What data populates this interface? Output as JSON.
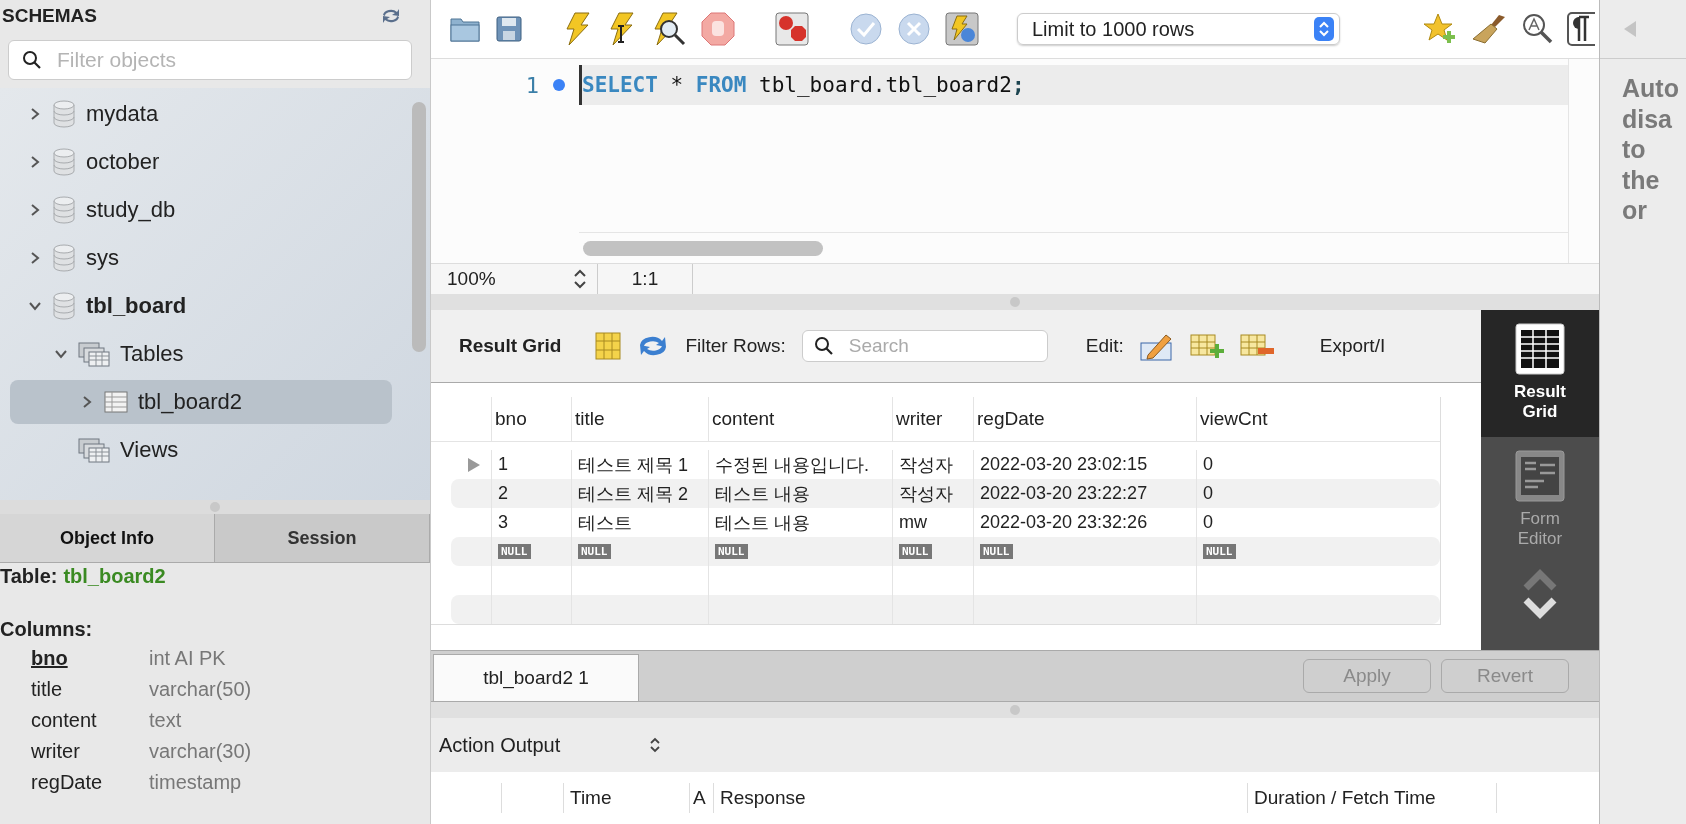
{
  "schemas_panel": {
    "title": "SCHEMAS",
    "filter": {
      "placeholder": "Filter objects"
    },
    "tree": [
      {
        "label": "mydata",
        "kind": "schema",
        "expanded": false,
        "selected": false
      },
      {
        "label": "october",
        "kind": "schema",
        "expanded": false,
        "selected": false
      },
      {
        "label": "study_db",
        "kind": "schema",
        "expanded": false,
        "selected": false
      },
      {
        "label": "sys",
        "kind": "schema",
        "expanded": false,
        "selected": false
      },
      {
        "label": "tbl_board",
        "kind": "schema",
        "expanded": true,
        "selected": false,
        "children": [
          {
            "label": "Tables",
            "kind": "folder",
            "expanded": true,
            "selected": false,
            "children": [
              {
                "label": "tbl_board2",
                "kind": "table",
                "expanded": false,
                "selected": true
              }
            ]
          },
          {
            "label": "Views",
            "kind": "folder",
            "selected": false
          }
        ]
      }
    ]
  },
  "info_tabs": [
    {
      "label": "Object Info",
      "selected": true
    },
    {
      "label": "Session",
      "selected": false
    }
  ],
  "object_info": {
    "table_label": "Table:",
    "table_name": "tbl_board2",
    "columns_label": "Columns:",
    "columns": [
      {
        "name": "bno",
        "type": "int AI PK",
        "primary": true
      },
      {
        "name": "title",
        "type": "varchar(50)",
        "primary": false
      },
      {
        "name": "content",
        "type": "text",
        "primary": false
      },
      {
        "name": "writer",
        "type": "varchar(30)",
        "primary": false
      },
      {
        "name": "regDate",
        "type": "timestamp",
        "primary": false
      }
    ]
  },
  "toolbar": {
    "limit": "Limit to 1000 rows"
  },
  "editor": {
    "lines": [
      {
        "number": "1",
        "tokens": [
          {
            "text": "SELECT",
            "kind": "keyword"
          },
          {
            "text": " * ",
            "kind": "plain"
          },
          {
            "text": "FROM",
            "kind": "keyword"
          },
          {
            "text": " tbl_board.tbl_board2",
            "kind": "plain"
          },
          {
            "text": ";",
            "kind": "punct"
          }
        ]
      }
    ],
    "zoom": "100%",
    "position": "1:1"
  },
  "result": {
    "title": "Result Grid",
    "filter_label": "Filter Rows:",
    "search_placeholder": "Search",
    "edit_label": "Edit:",
    "export_label": "Export/I",
    "columns": [
      "bno",
      "title",
      "content",
      "writer",
      "regDate",
      "viewCnt"
    ],
    "rows": [
      {
        "kind": "data",
        "current": true,
        "cells": [
          "1",
          "테스트 제목 1",
          "수정된 내용입니다.",
          "작성자",
          "2022-03-20 23:02:15",
          "0"
        ]
      },
      {
        "kind": "data",
        "current": false,
        "cells": [
          "2",
          "테스트 제목 2",
          "테스트 내용",
          "작성자",
          "2022-03-20 23:22:27",
          "0"
        ]
      },
      {
        "kind": "data",
        "current": false,
        "cells": [
          "3",
          "테스트",
          "테스트 내용",
          "mw",
          "2022-03-20 23:32:26",
          "0"
        ]
      },
      {
        "kind": "new",
        "current": false,
        "cells": [
          "NULL",
          "NULL",
          "NULL",
          "NULL",
          "NULL",
          "NULL"
        ]
      }
    ],
    "side_tabs": [
      {
        "label": "Result Grid",
        "selected": true
      },
      {
        "label": "Form Editor",
        "selected": false
      }
    ],
    "tabs": [
      {
        "label": "tbl_board2 1",
        "selected": true
      }
    ],
    "buttons": [
      {
        "label": "Apply",
        "disabled": true
      },
      {
        "label": "Revert",
        "disabled": true
      }
    ]
  },
  "output": {
    "title": "Action Output",
    "columns": [
      "Time",
      "A",
      "Response",
      "Duration / Fetch Time"
    ]
  },
  "help_panel": {
    "lines": [
      "Auto",
      "disa",
      "to",
      "the",
      "or"
    ]
  }
}
